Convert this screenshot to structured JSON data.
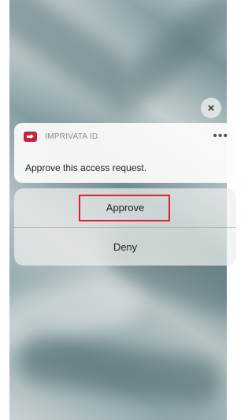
{
  "notification": {
    "app_name": "IMPRIVATA ID",
    "more_label": "•••",
    "message": "Approve this access request.",
    "close_label": "×"
  },
  "actions": {
    "approve_label": "Approve",
    "deny_label": "Deny"
  },
  "icons": {
    "app": "imprivata-logo-icon",
    "close": "close-icon",
    "more": "more-icon"
  },
  "colors": {
    "brand": "#c8203a",
    "highlight": "#e0202a"
  }
}
